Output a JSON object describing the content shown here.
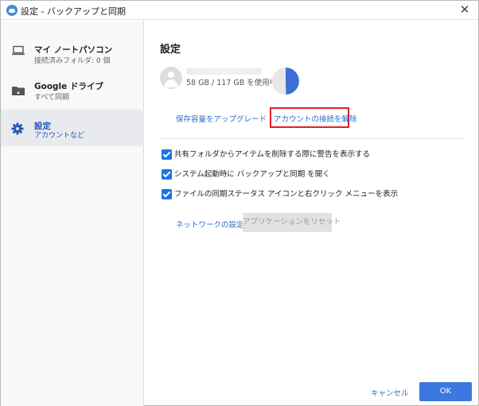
{
  "window": {
    "title": "設定 - バックアップと同期"
  },
  "sidebar": {
    "items": [
      {
        "title": "マイ ノートパソコン",
        "subtitle": "接続済みフォルダ: 0 個",
        "icon": "laptop-icon"
      },
      {
        "title": "Google ドライブ",
        "subtitle": "すべて同期",
        "icon": "drive-folder-icon"
      },
      {
        "title": "設定",
        "subtitle": "アカウントなど",
        "icon": "gear-icon",
        "active": true
      }
    ]
  },
  "settings": {
    "heading": "設定",
    "storage_text": "58 GB / 117 GB を使用中",
    "storage_used_fraction": 0.496,
    "upgrade_link": "保存容量をアップグレード",
    "disconnect_link": "アカウントの接続を解除",
    "checkboxes": [
      {
        "label": "共有フォルダからアイテムを削除する際に警告を表示する",
        "checked": true
      },
      {
        "label": "システム起動時に バックアップと同期 を開く",
        "checked": true
      },
      {
        "label": "ファイルの同期ステータス アイコンと右クリック メニューを表示",
        "checked": true
      }
    ],
    "network_link": "ネットワークの設定",
    "reset_button": "アプリケーションをリセット"
  },
  "footer": {
    "cancel_label": "キャンセル",
    "ok_label": "OK"
  },
  "colors": {
    "accent": "#3b78e0",
    "highlight_box": "#e12020",
    "pie_used": "#3b6fd6",
    "pie_free": "#e6e6e6"
  }
}
